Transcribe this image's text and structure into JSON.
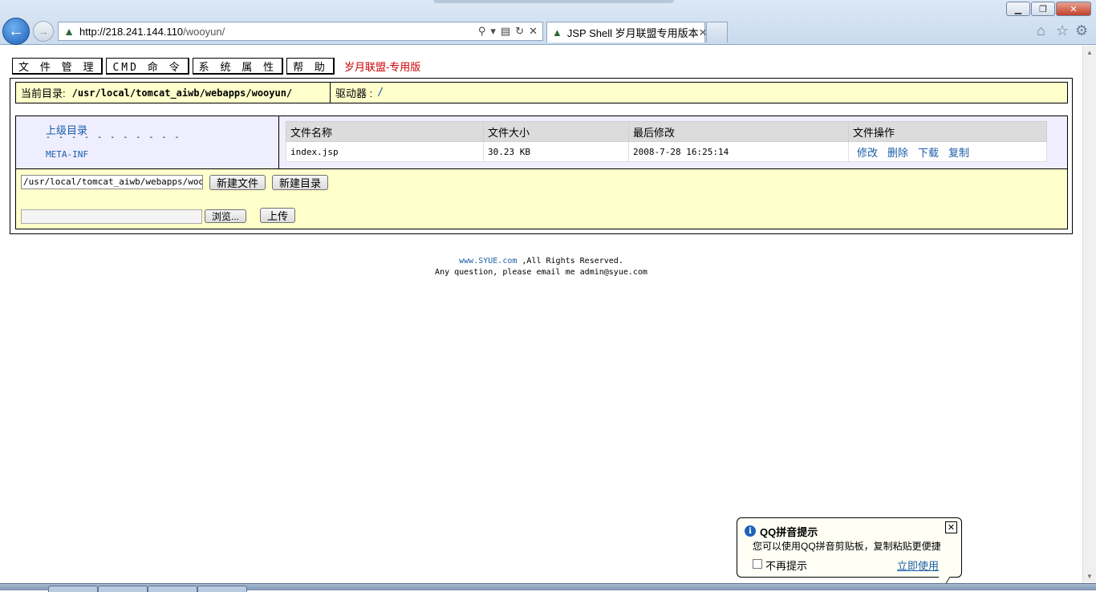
{
  "browser": {
    "url_host": "http://218.241.144.110",
    "url_path": "/wooyun/",
    "tab_title": "JSP Shell 岁月联盟专用版本",
    "window_buttons": [
      "minimize",
      "restore",
      "close"
    ]
  },
  "menu": {
    "items": [
      "文 件 管 理",
      "CMD 命 令",
      "系 统 属 性",
      "帮 助"
    ],
    "brand": "岁月联盟-专用版"
  },
  "pathbar": {
    "current_label": "当前目录:",
    "current_path": "/usr/local/tomcat_aiwb/webapps/wooyun/",
    "drive_label": "驱动器 :",
    "drive_value": "/"
  },
  "leftpane": {
    "up_link": "上级目录",
    "separator": "- - - - - - - - - - -",
    "dirs": [
      "META-INF"
    ]
  },
  "filetable": {
    "headers": [
      "文件名称",
      "文件大小",
      "最后修改",
      "文件操作"
    ],
    "rows": [
      {
        "name": "index.jsp",
        "size": "30.23 KB",
        "modified": "2008-7-28 16:25:14",
        "ops": [
          "修改",
          "删除",
          "下载",
          "复制"
        ]
      }
    ]
  },
  "form": {
    "path_value": "/usr/local/tomcat_aiwb/webapps/wooyun/",
    "new_file": "新建文件",
    "new_dir": "新建目录",
    "browse": "浏览...",
    "upload": "上传"
  },
  "footer": {
    "site": "www.SYUE.com",
    "rights": " ,All Rights Reserved.",
    "contact": "Any question, please email me admin@syue.com"
  },
  "qq_popup": {
    "title": "QQ拼音提示",
    "message": "您可以使用QQ拼音剪贴板，复制粘贴更便捷",
    "checkbox_label": "不再提示",
    "action": "立即使用"
  }
}
